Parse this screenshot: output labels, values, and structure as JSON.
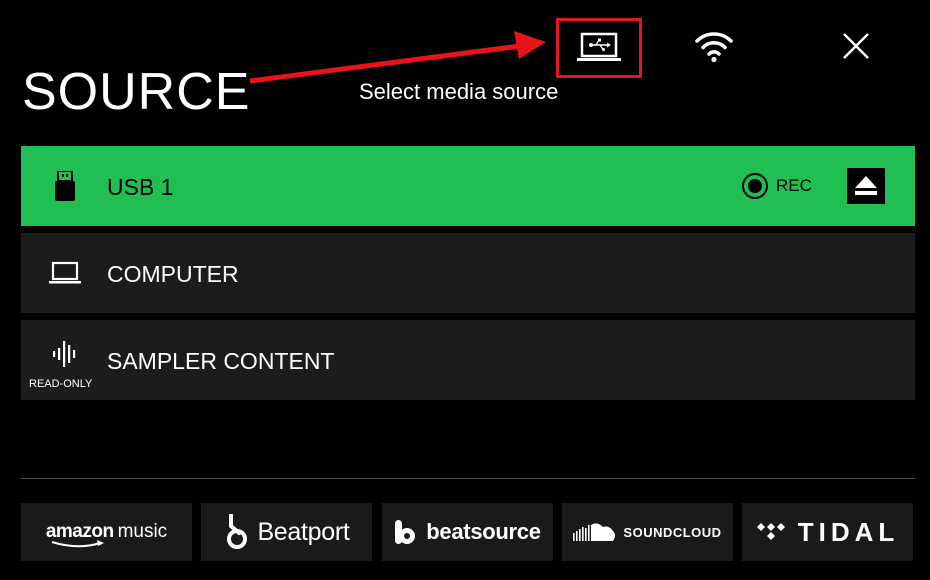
{
  "header": {
    "title": "SOURCE",
    "subtitle": "Select media source"
  },
  "top_icons": {
    "usb_computer": "laptop-usb-icon",
    "wifi": "wifi-icon",
    "close": "close-icon"
  },
  "colors": {
    "active_row": "#21bf53",
    "row": "#1c1c1c",
    "highlight_box": "#e8141b",
    "background": "#000000"
  },
  "sources": [
    {
      "label": "USB 1",
      "icon": "usb-drive-icon",
      "active": true,
      "rec_label": "REC"
    },
    {
      "label": "COMPUTER",
      "icon": "laptop-icon",
      "active": false
    },
    {
      "label": "SAMPLER CONTENT",
      "icon": "waveform-icon",
      "active": false,
      "badge": "READ-ONLY"
    }
  ],
  "services": {
    "amazon": {
      "brand": "amazon",
      "suffix": "music"
    },
    "beatport": {
      "label": "Beatport"
    },
    "beatsource": {
      "label": "beatsource"
    },
    "soundcloud": {
      "label": "SOUNDCLOUD"
    },
    "tidal": {
      "label": "TIDAL"
    }
  }
}
